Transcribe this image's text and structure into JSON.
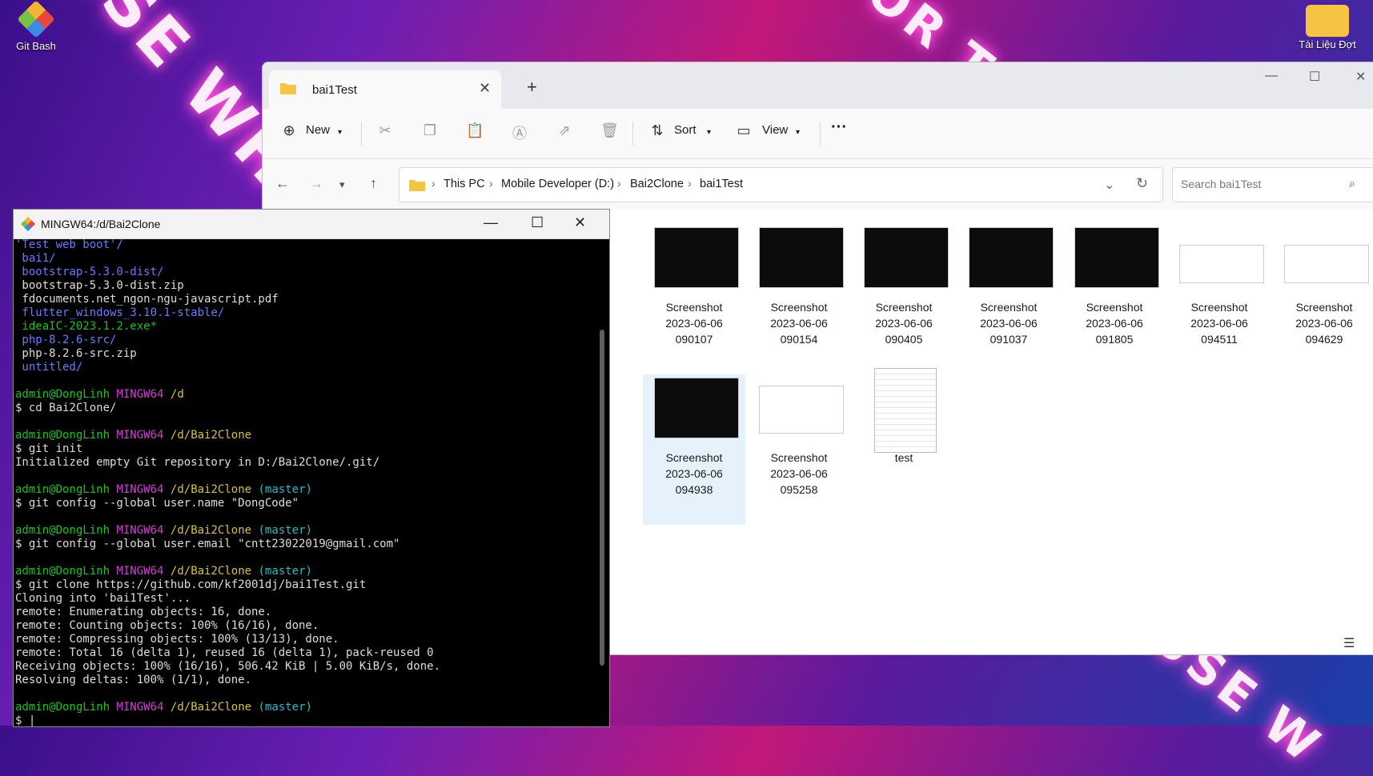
{
  "desktop": {
    "icons": [
      {
        "label": "Git Bash"
      },
      {
        "label": "Tài Liệu Đợt"
      }
    ]
  },
  "explorer": {
    "tab_title": "bai1Test",
    "toolbar": {
      "new": "New",
      "sort": "Sort",
      "view": "View"
    },
    "breadcrumb": [
      "This PC",
      "Mobile Developer (D:)",
      "Bai2Clone",
      "bai1Test"
    ],
    "search_placeholder": "Search bai1Test",
    "files": [
      {
        "line1": "Screenshot",
        "line2": "2023-06-06",
        "line3": "090107",
        "thumb": "dark"
      },
      {
        "line1": "Screenshot",
        "line2": "2023-06-06",
        "line3": "090154",
        "thumb": "dark"
      },
      {
        "line1": "Screenshot",
        "line2": "2023-06-06",
        "line3": "090405",
        "thumb": "dark"
      },
      {
        "line1": "Screenshot",
        "line2": "2023-06-06",
        "line3": "091037",
        "thumb": "dark"
      },
      {
        "line1": "Screenshot",
        "line2": "2023-06-06",
        "line3": "091805",
        "thumb": "dark"
      },
      {
        "line1": "Screenshot",
        "line2": "2023-06-06",
        "line3": "094511",
        "thumb": "light"
      },
      {
        "line1": "Screenshot",
        "line2": "2023-06-06",
        "line3": "094629",
        "thumb": "light"
      },
      {
        "line1": "Screenshot",
        "line2": "2023-06-06",
        "line3": "094938",
        "thumb": "dark",
        "selected": true
      },
      {
        "line1": "Screenshot",
        "line2": "2023-06-06",
        "line3": "095258",
        "thumb": "light"
      },
      {
        "line1": "test",
        "line2": "",
        "line3": "",
        "thumb": "doc"
      }
    ]
  },
  "terminal": {
    "title": "MINGW64:/d/Bai2Clone",
    "lines": [
      {
        "text": "'Test web boot'/",
        "color": "blue"
      },
      {
        "text": " bai1/",
        "color": "blue"
      },
      {
        "text": " bootstrap-5.3.0-dist/",
        "color": "blue"
      },
      {
        "text": " bootstrap-5.3.0-dist.zip",
        "color": ""
      },
      {
        "text": " fdocuments.net_ngon-ngu-javascript.pdf",
        "color": ""
      },
      {
        "text": " flutter_windows_3.10.1-stable/",
        "color": "blue"
      },
      {
        "text": " ideaIC-2023.1.2.exe*",
        "color": "green"
      },
      {
        "text": " php-8.2.6-src/",
        "color": "blue"
      },
      {
        "text": " php-8.2.6-src.zip",
        "color": ""
      },
      {
        "text": " untitled/",
        "color": "blue"
      },
      {
        "text": "",
        "color": ""
      },
      {
        "prompt": true,
        "user": "admin@DongLinh",
        "sys": "MINGW64",
        "path": "/d",
        "branch": ""
      },
      {
        "text": "$ cd Bai2Clone/",
        "color": ""
      },
      {
        "text": "",
        "color": ""
      },
      {
        "prompt": true,
        "user": "admin@DongLinh",
        "sys": "MINGW64",
        "path": "/d/Bai2Clone",
        "branch": ""
      },
      {
        "text": "$ git init",
        "color": ""
      },
      {
        "text": "Initialized empty Git repository in D:/Bai2Clone/.git/",
        "color": ""
      },
      {
        "text": "",
        "color": ""
      },
      {
        "prompt": true,
        "user": "admin@DongLinh",
        "sys": "MINGW64",
        "path": "/d/Bai2Clone",
        "branch": "(master)"
      },
      {
        "text": "$ git config --global user.name \"DongCode\"",
        "color": ""
      },
      {
        "text": "",
        "color": ""
      },
      {
        "prompt": true,
        "user": "admin@DongLinh",
        "sys": "MINGW64",
        "path": "/d/Bai2Clone",
        "branch": "(master)"
      },
      {
        "text": "$ git config --global user.email \"cntt23022019@gmail.com\"",
        "color": ""
      },
      {
        "text": "",
        "color": ""
      },
      {
        "prompt": true,
        "user": "admin@DongLinh",
        "sys": "MINGW64",
        "path": "/d/Bai2Clone",
        "branch": "(master)"
      },
      {
        "text": "$ git clone https://github.com/kf2001dj/bai1Test.git",
        "color": ""
      },
      {
        "text": "Cloning into 'bai1Test'...",
        "color": ""
      },
      {
        "text": "remote: Enumerating objects: 16, done.",
        "color": ""
      },
      {
        "text": "remote: Counting objects: 100% (16/16), done.",
        "color": ""
      },
      {
        "text": "remote: Compressing objects: 100% (13/13), done.",
        "color": ""
      },
      {
        "text": "remote: Total 16 (delta 1), reused 16 (delta 1), pack-reused 0",
        "color": ""
      },
      {
        "text": "Receiving objects: 100% (16/16), 506.42 KiB | 5.00 KiB/s, done.",
        "color": ""
      },
      {
        "text": "Resolving deltas: 100% (1/1), done.",
        "color": ""
      },
      {
        "text": "",
        "color": ""
      },
      {
        "prompt": true,
        "user": "admin@DongLinh",
        "sys": "MINGW64",
        "path": "/d/Bai2Clone",
        "branch": "(master)"
      },
      {
        "text": "$ |",
        "color": ""
      }
    ]
  }
}
